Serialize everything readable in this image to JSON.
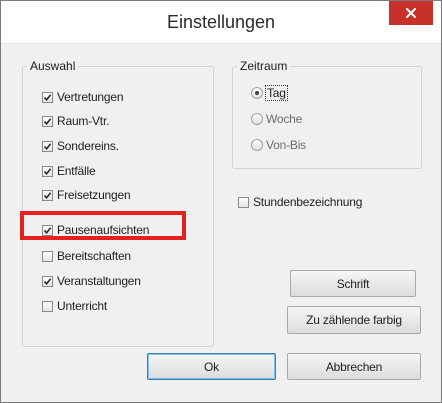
{
  "window": {
    "title": "Einstellungen"
  },
  "auswahl": {
    "legend": "Auswahl",
    "items": [
      {
        "label": "Vertretungen",
        "checked": true
      },
      {
        "label": "Raum-Vtr.",
        "checked": true
      },
      {
        "label": "Sondereins.",
        "checked": true
      },
      {
        "label": "Entfälle",
        "checked": true
      },
      {
        "label": "Freisetzungen",
        "checked": true
      },
      {
        "label": "Pausenaufsichten",
        "checked": true
      },
      {
        "label": "Bereitschaften",
        "checked": false
      },
      {
        "label": "Veranstaltungen",
        "checked": true
      },
      {
        "label": "Unterricht",
        "checked": false
      }
    ]
  },
  "zeitraum": {
    "legend": "Zeitraum",
    "options": [
      {
        "label": "Tag",
        "selected": true
      },
      {
        "label": "Woche",
        "selected": false
      },
      {
        "label": "Von-Bis",
        "selected": false
      }
    ]
  },
  "stundenbezeichnung": {
    "label": "Stundenbezeichnung",
    "checked": false
  },
  "buttons": {
    "schrift": "Schrift",
    "zu_zaehlende": "Zu zählende farbig",
    "ok": "Ok",
    "abbrechen": "Abbrechen"
  },
  "colors": {
    "close": "#c7312a",
    "highlight": "#e3221f",
    "focus_border": "#3c7fb1"
  },
  "icons": {
    "close": "close-icon",
    "check": "checkmark-icon"
  }
}
